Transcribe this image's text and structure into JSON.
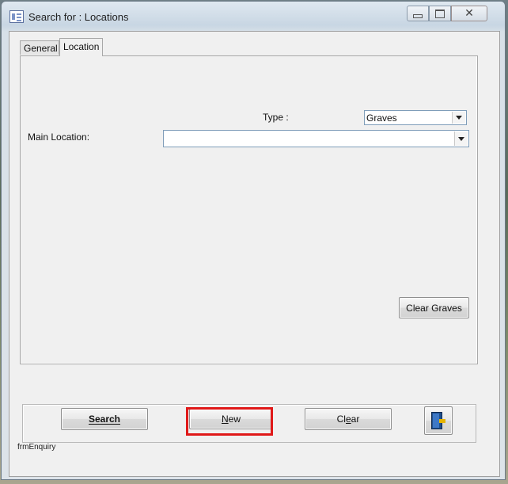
{
  "window": {
    "title": "Search for : Locations",
    "caption_buttons": {
      "minimize_icon": "minimize-icon",
      "maximize_icon": "maximize-icon",
      "close_icon": "close-icon",
      "close_glyph": "✕"
    }
  },
  "tabs": [
    {
      "label": "General",
      "active": false
    },
    {
      "label": "Location",
      "active": true
    }
  ],
  "location_tab": {
    "type_label": "Type :",
    "type_value": "Graves",
    "main_location_label": "Main Location:",
    "main_location_value": "",
    "clear_graves_label": "Clear Graves"
  },
  "toolbar": {
    "search_label": "Search",
    "search_accesskey": "S",
    "new_label": "New",
    "new_accesskey": "N",
    "clear_label": "Clear",
    "clear_accesskey": "e",
    "exit_icon": "exit-door-icon"
  },
  "form_name": "frmEnquiry",
  "colors": {
    "highlight": "#e01919",
    "window_bg": "#f0f0f0"
  }
}
